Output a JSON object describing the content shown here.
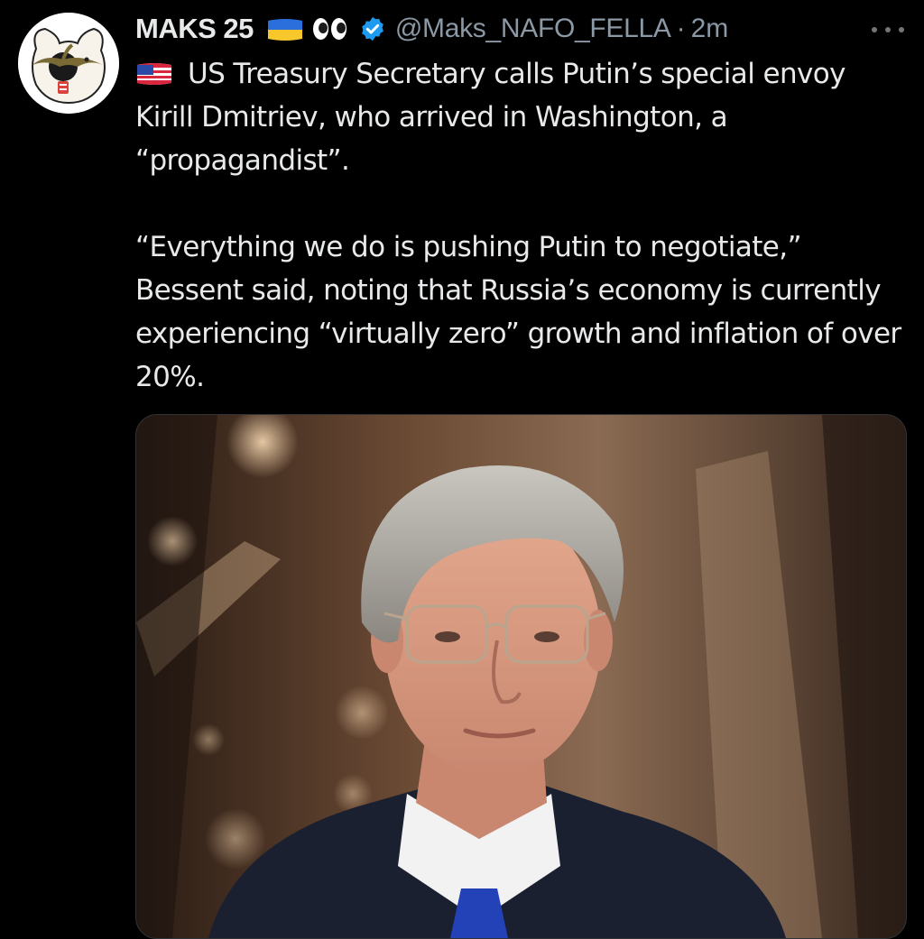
{
  "author": {
    "display_name": "MAKS 25",
    "handle": "@Maks_NAFO_FELLA",
    "separator": "·",
    "time": "2m",
    "badges": [
      "ukraine-flag-emoji",
      "eyes-emoji",
      "verified-badge-icon"
    ]
  },
  "tweet": {
    "paragraph1": "US Treasury Secretary calls Putin’s special envoy Kirill Dmitriev, who arrived in Washington, a “propagandist”.",
    "paragraph1_prefix_icon": "us-flag-emoji",
    "paragraph2": "“Everything we do is pushing Putin to negotiate,” Bessent said, noting that Russia’s economy is currently experiencing “virtually zero” growth and inflation of over 20%."
  },
  "media": {
    "type": "photo"
  },
  "colors": {
    "background": "#000000",
    "text": "#e7e9ea",
    "secondary_text": "#8b98a5",
    "verified_blue": "#1d9bf0"
  },
  "icons": {
    "more": "more-horizontal-icon",
    "verified": "verified-badge-icon"
  }
}
